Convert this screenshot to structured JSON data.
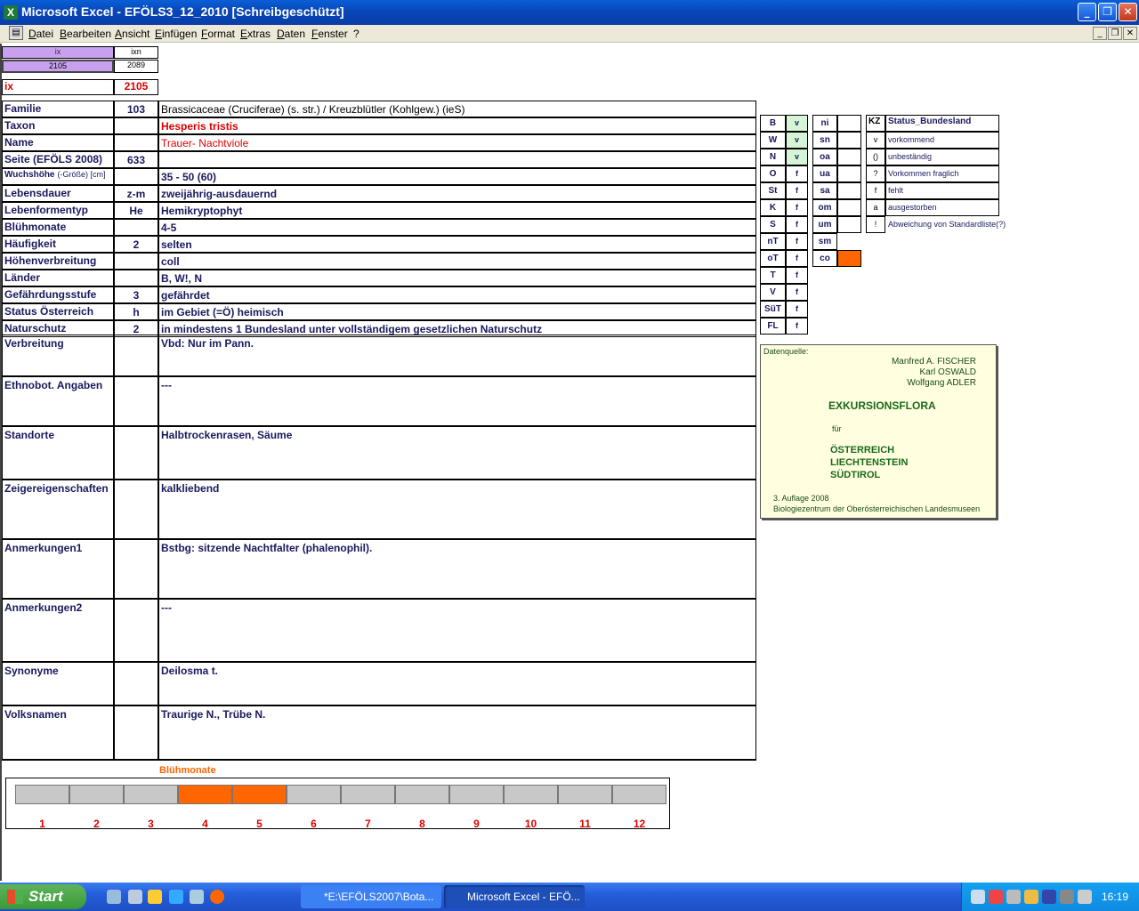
{
  "window": {
    "title": "Microsoft Excel - EFÖLS3_12_2010  [Schreibgeschützt]"
  },
  "menu": [
    "Datei",
    "Bearbeiten",
    "Ansicht",
    "Einfügen",
    "Format",
    "Extras",
    "Daten",
    "Fenster",
    "?"
  ],
  "index": {
    "ix_header": "ix",
    "ixn_header": "ixn",
    "ix_value": "2105",
    "ixn_value": "2089",
    "ix_label": "ix",
    "ix_big": "2105"
  },
  "fields": [
    {
      "label": "Familie",
      "code": "103",
      "value": "Brassicaceae (Cruciferae) (s. str.)  /  Kreuzblütler (Kohlgew.) (ieS)"
    },
    {
      "label": "Taxon",
      "code": "",
      "value": "Hesperis tristis"
    },
    {
      "label": "Name",
      "code": "",
      "value": "Trauer- Nachtviole"
    },
    {
      "label": "Seite (EFÖLS 2008)",
      "code": "633",
      "value": ""
    },
    {
      "label": "Wuchshöhe",
      "label_suffix": "(-Größe) [cm]",
      "code": "",
      "value": " 35 - 50 (60)"
    },
    {
      "label": "Lebensdauer",
      "code": "z-m",
      "value": "zweijährig-ausdauernd"
    },
    {
      "label": "Lebenformentyp",
      "code": "He",
      "value": "Hemikryptophyt"
    },
    {
      "label": "Blühmonate",
      "code": "",
      "value": " 4-5"
    },
    {
      "label": "Häufigkeit",
      "code": "2",
      "value": "selten"
    },
    {
      "label": "Höhenverbreitung",
      "code": "",
      "value": "coll"
    },
    {
      "label": "Länder",
      "code": "",
      "value": "B, W!, N"
    },
    {
      "label": "Gefährdungsstufe",
      "code": "3",
      "value": "gefährdet"
    },
    {
      "label": "Status Österreich",
      "code": "h",
      "value": "im Gebiet (=Ö) heimisch"
    },
    {
      "label": "Naturschutz",
      "code": "2",
      "value": "in mindestens 1 Bundesland unter vollständigem gesetzlichen Naturschutz"
    }
  ],
  "tall_fields": [
    {
      "label": "Verbreitung",
      "value": "Vbd: Nur im Pann."
    },
    {
      "label": "Ethnobot. Angaben",
      "value": "---"
    },
    {
      "label": "Standorte",
      "value": "Halbtrockenrasen, Säume"
    },
    {
      "label": "Zeigereigenschaften",
      "value": "kalkliebend"
    },
    {
      "label": "Anmerkungen1",
      "value": "Bstbg: sitzende Nachtfalter (phalenophil)."
    },
    {
      "label": "Anmerkungen2",
      "value": "---"
    },
    {
      "label": "Synonyme",
      "value": "Deilosma t."
    },
    {
      "label": "Volksnamen",
      "value": "Traurige N., Trübe N."
    }
  ],
  "states": [
    {
      "code": "B",
      "status": "v"
    },
    {
      "code": "W",
      "status": "v"
    },
    {
      "code": "N",
      "status": "v"
    },
    {
      "code": "O",
      "status": "f"
    },
    {
      "code": "St",
      "status": "f"
    },
    {
      "code": "K",
      "status": "f"
    },
    {
      "code": "S",
      "status": "f"
    },
    {
      "code": "nT",
      "status": "f"
    },
    {
      "code": "oT",
      "status": "f"
    },
    {
      "code": "T",
      "status": "f"
    },
    {
      "code": "V",
      "status": "f"
    },
    {
      "code": "SüT",
      "status": "f"
    },
    {
      "code": "FL",
      "status": "f"
    }
  ],
  "regions": [
    "ni",
    "sn",
    "oa",
    "ua",
    "sa",
    "om",
    "um",
    "sm",
    "co"
  ],
  "legend": {
    "header_kz": "KZ",
    "header_title": "Status_Bundesland",
    "rows": [
      {
        "kz": "v",
        "text": "vorkommend"
      },
      {
        "kz": "()",
        "text": "unbeständig"
      },
      {
        "kz": "?",
        "text": "Vorkommen fraglich"
      },
      {
        "kz": "f",
        "text": "fehlt"
      },
      {
        "kz": "a",
        "text": "ausgestorben"
      },
      {
        "kz": "!",
        "text": "Abweichung von Standardliste(?)"
      }
    ]
  },
  "source": {
    "label": "Datenquelle:",
    "authors": [
      "Manfred A. FISCHER",
      "Karl OSWALD",
      "Wolfgang ADLER"
    ],
    "book": "EXKURSIONSFLORA",
    "fuer": "für",
    "countries": [
      "ÖSTERREICH",
      "LIECHTENSTEIN",
      "SÜDTIROL"
    ],
    "edition": "3. Auflage 2008",
    "publisher": "Biologiezentrum der Oberösterreichischen Landesmuseen"
  },
  "bloom": {
    "title": "Blühmonate",
    "months": [
      "1",
      "2",
      "3",
      "4",
      "5",
      "6",
      "7",
      "8",
      "9",
      "10",
      "11",
      "12"
    ],
    "active": [
      4,
      5
    ],
    "active_color": "#ff6600"
  },
  "taskbar": {
    "start": "Start",
    "tasks": [
      "*E:\\EFÖLS2007\\Bota...",
      "Microsoft Excel - EFÖ..."
    ],
    "clock": "16:19"
  }
}
